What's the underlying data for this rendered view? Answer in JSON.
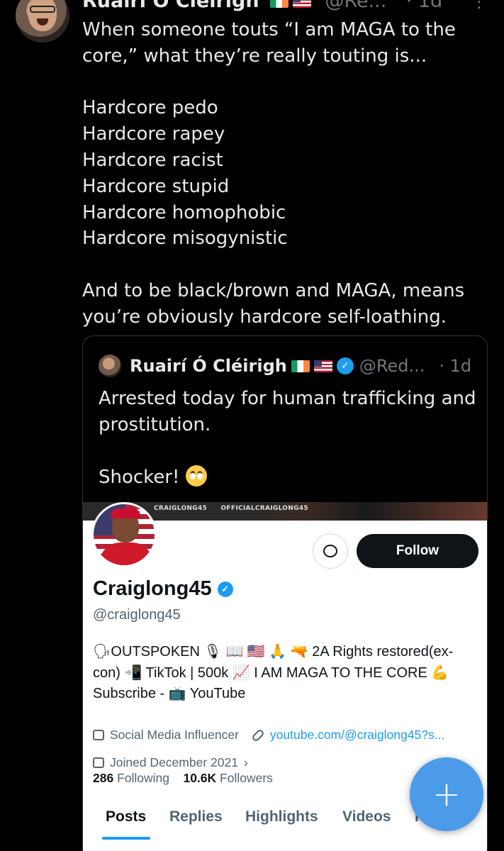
{
  "post": {
    "author": "Ruairí Ó Cléirigh",
    "handle": "@Re...",
    "time": "· 1d",
    "lines": [
      "When someone touts “I am MAGA to the",
      "core,” what they’re really touting is...",
      "",
      "Hardcore pedo",
      "Hardcore rapey",
      "Hardcore racist",
      "Hardcore stupid",
      "Hardcore homophobic",
      "Hardcore misogynistic",
      "",
      "And to be black/brown and MAGA, means",
      "you’re obviously hardcore self-loathing."
    ]
  },
  "quote": {
    "author": "Ruairí Ó Cléirigh",
    "handle": "@Red...",
    "time": "· 1d",
    "line1": "Arrested today for human trafficking and",
    "line2": "prostitution.",
    "line3": "Shocker!"
  },
  "profile": {
    "banner_left": "CRAIGLONG45",
    "banner_right": "OFFICIALCRAIGLONG45",
    "follow_label": "Follow",
    "name": "Craiglong45",
    "handle": "@craiglong45",
    "bio_line1": "🗣OUTSPOKEN 🎙 📖 🇺🇸 🙏 🔫 2A Rights restored(ex-",
    "bio_line2": "con) 📲 TikTok | 500k 📈 I AM MAGA TO THE CORE 💪",
    "bio_line3": "Subscribe - 📺 YouTube",
    "category": "Social Media Influencer",
    "link": "youtube.com/@craiglong45?s...",
    "joined": "Joined December 2021",
    "following_count": "286",
    "following_label": "Following",
    "followers_count": "10.6K",
    "followers_label": "Followers",
    "tabs": [
      "Posts",
      "Replies",
      "Highlights",
      "Videos",
      "P"
    ]
  },
  "fab_label": "+",
  "colors": {
    "accent": "#1d9bf0",
    "fab": "#4c9be8",
    "background": "#000000"
  }
}
